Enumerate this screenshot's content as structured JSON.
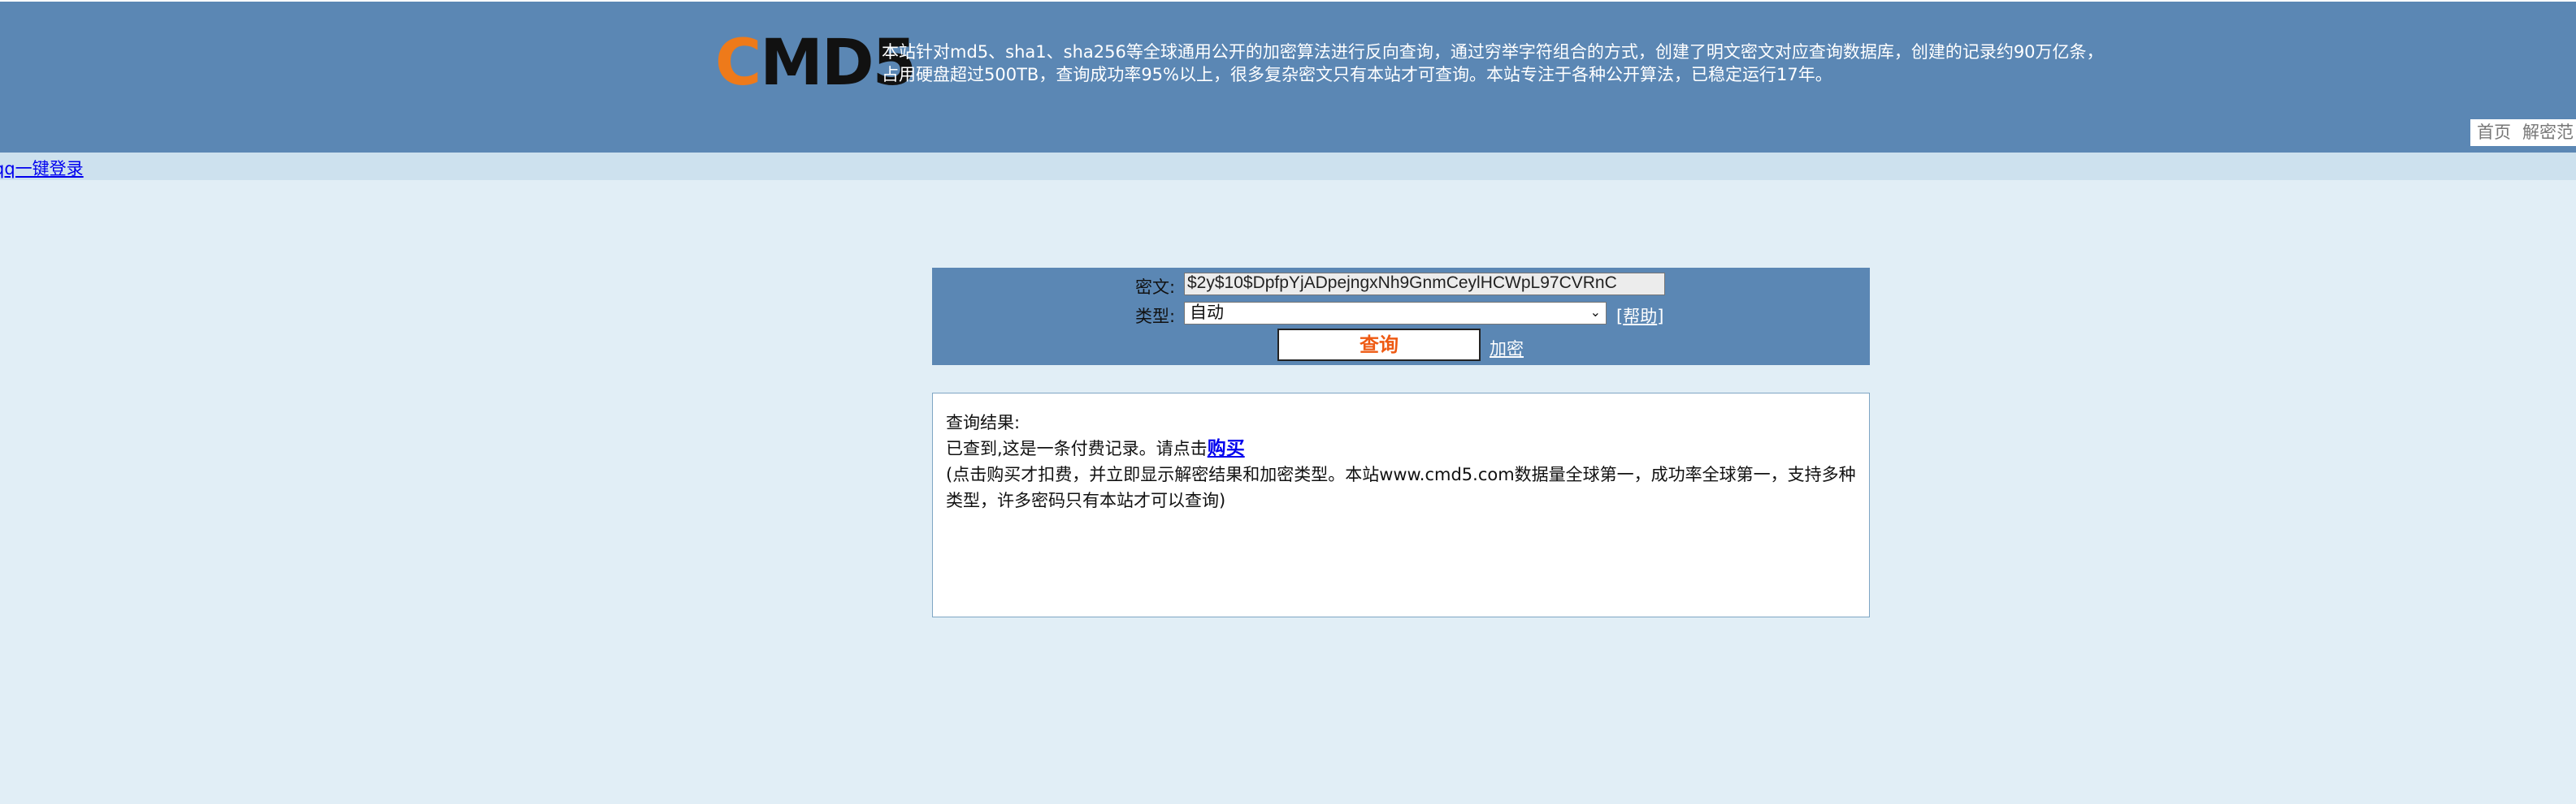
{
  "header": {
    "logo_first": "C",
    "logo_rest": "MD5",
    "intro_line1": "本站针对md5、sha1、sha256等全球通用公开的加密算法进行反向查询，通过穷举字符组合的方式，创建了明文密文对应查询数据库，创建的记录约90万亿条，",
    "intro_line2": "占用硬盘超过500TB，查询成功率95%以上，很多复杂密文只有本站才可查询。本站专注于各种公开算法，已稳定运行17年。",
    "nav": [
      "首页",
      "解密范"
    ]
  },
  "subbar": {
    "qq_login": "qq一键登录"
  },
  "query": {
    "cipher_label": "密文:",
    "cipher_value": "$2y$10$DpfpYjADpejngxNh9GnmCeylHCWpL97CVRnC",
    "type_label": "类型:",
    "type_value": "自动",
    "help_text": "帮助",
    "query_button": "查询",
    "encrypt_link": "加密"
  },
  "result": {
    "title": "查询结果:",
    "found_text": "已查到,这是一条付费记录。请点击",
    "buy_link": "购买",
    "note": "(点击购买才扣费，并立即显示解密结果和加密类型。本站www.cmd5.com数据量全球第一，成功率全球第一，支持多种类型，许多密码只有本站才可以查询)"
  },
  "colors": {
    "header_bg": "#5b87b4",
    "page_bg": "#e1eef6",
    "subbar_bg": "#cde1ee",
    "logo_accent": "#ee7a1a",
    "button_text": "#ee5a13"
  }
}
